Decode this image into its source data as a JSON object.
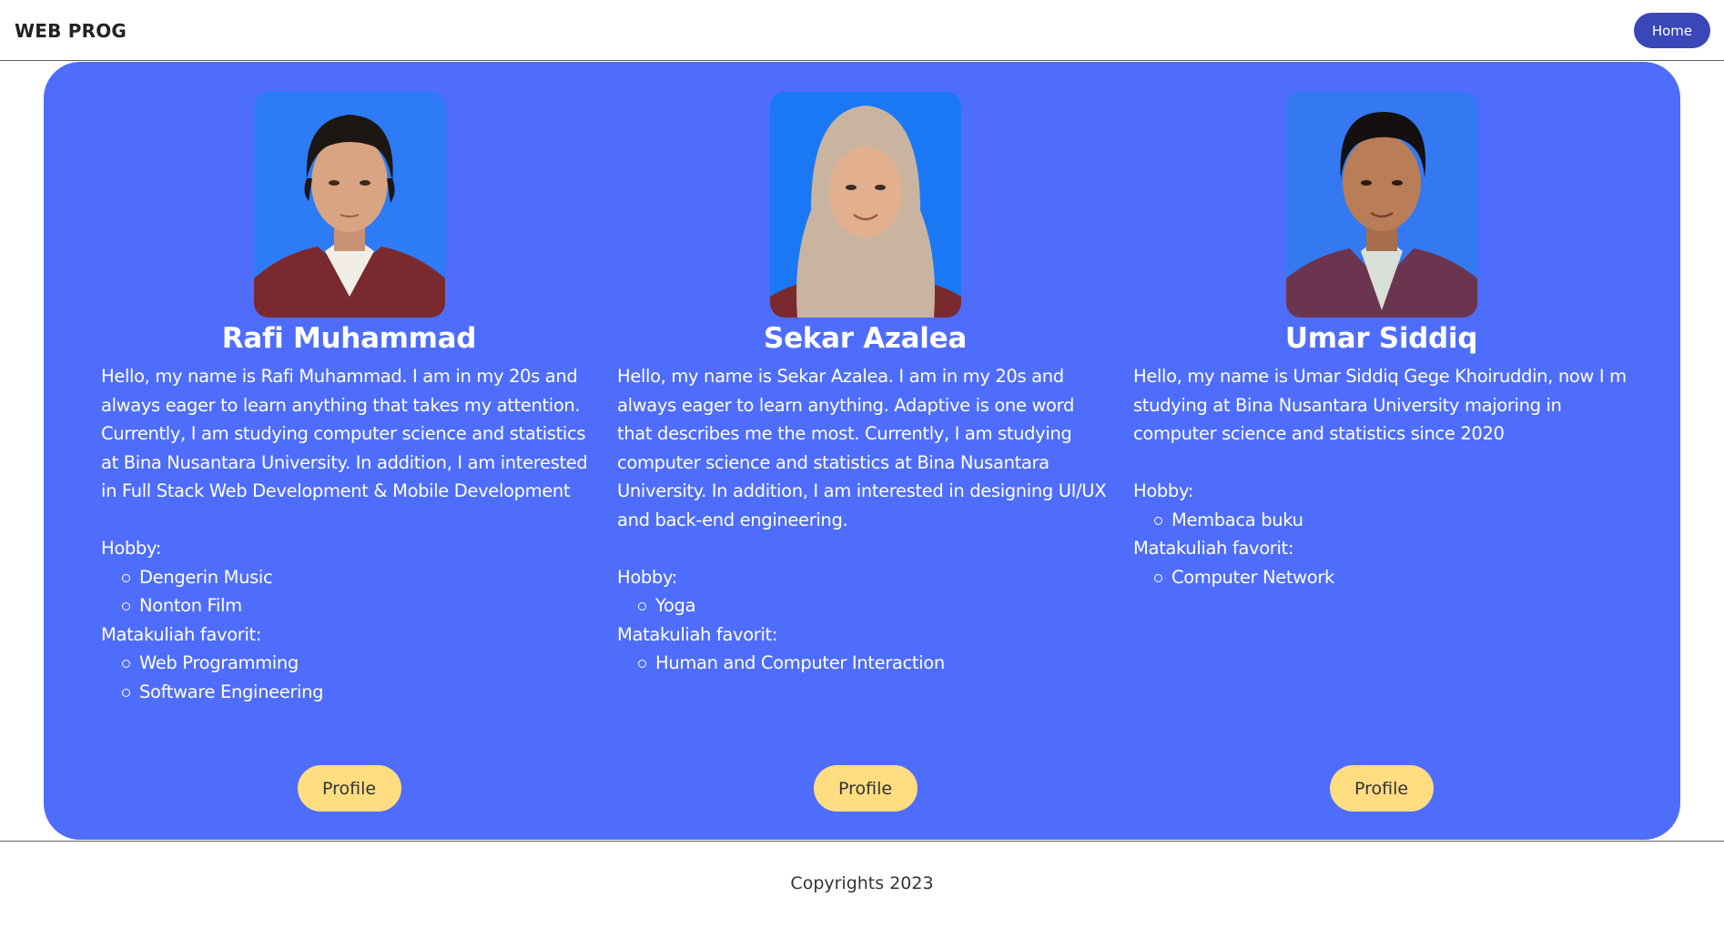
{
  "brand": "WEB PROG",
  "nav": {
    "home_label": "Home"
  },
  "colors": {
    "panel": "#4e6dfd",
    "home_button": "#3947b8",
    "profile_button": "#ffdd80",
    "photo_background": "#2e7bf6"
  },
  "members": [
    {
      "name": "Rafi Muhammad",
      "bio": "Hello, my name is Rafi Muhammad. I am in my 20s and always eager to learn anything that takes my attention. Currently, I am studying computer science and statistics at Bina Nusantara University. In addition, I am interested in Full Stack Web Development & Mobile Development",
      "hobby_label": "Hobby:",
      "hobbies": [
        "Dengerin Music",
        "Nonton Film"
      ],
      "courses_label": "Matakuliah favorit:",
      "courses": [
        "Web Programming",
        "Software Engineering"
      ],
      "button_label": "Profile"
    },
    {
      "name": "Sekar Azalea",
      "bio": "Hello, my name is Sekar Azalea. I am in my 20s and always eager to learn anything. Adaptive is one word that describes me the most. Currently, I am studying computer science and statistics at Bina Nusantara University. In addition, I am interested in designing UI/UX and back-end engineering.",
      "hobby_label": "Hobby:",
      "hobbies": [
        "Yoga"
      ],
      "courses_label": "Matakuliah favorit:",
      "courses": [
        "Human and Computer Interaction"
      ],
      "button_label": "Profile"
    },
    {
      "name": "Umar Siddiq",
      "bio": "Hello, my name is Umar Siddiq Gege Khoiruddin, now I m studying at Bina Nusantara University majoring in computer science and statistics since 2020",
      "hobby_label": "Hobby:",
      "hobbies": [
        "Membaca buku"
      ],
      "courses_label": "Matakuliah favorit:",
      "courses": [
        "Computer Network"
      ],
      "button_label": "Profile"
    }
  ],
  "footer": {
    "text": "Copyrights 2023"
  }
}
